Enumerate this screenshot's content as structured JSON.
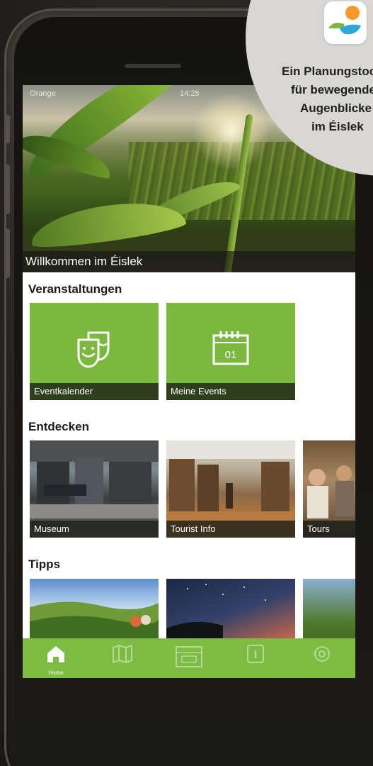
{
  "status_bar": {
    "carrier": "Orange",
    "time": "14:28"
  },
  "hero": {
    "caption": "Willkommen im Éislek"
  },
  "sections": {
    "events": {
      "title": "Veranstaltungen",
      "tiles": [
        {
          "label": "Eventkalender",
          "icon": "theater-masks-icon"
        },
        {
          "label": "Meine Events",
          "icon": "calendar-icon",
          "icon_text": "01"
        }
      ]
    },
    "discover": {
      "title": "Entdecken",
      "tiles": [
        {
          "label": "Museum"
        },
        {
          "label": "Tourist Info"
        },
        {
          "label": "Tours"
        }
      ]
    },
    "tips": {
      "title": "Tipps"
    }
  },
  "tabbar": {
    "items": [
      {
        "label": "Home",
        "icon": "home-icon",
        "active": true
      },
      {
        "label": "",
        "icon": "map-icon",
        "active": false
      },
      {
        "label": "",
        "icon": "calendar-icon",
        "active": false
      },
      {
        "label": "",
        "icon": "info-icon",
        "active": false
      },
      {
        "label": "",
        "icon": "settings-icon",
        "active": false
      }
    ]
  },
  "promo": {
    "lines": [
      "Ein Planungstool",
      "für bewegende",
      "Augenblicke",
      "im Éislek"
    ]
  },
  "colors": {
    "brand_green": "#7ab93e",
    "tabbar_green": "#7dbb42",
    "badge_gray": "#d9d7d3",
    "logo_orange": "#f39a2a",
    "logo_blue": "#2fa7d9",
    "logo_green": "#7ab93e"
  }
}
